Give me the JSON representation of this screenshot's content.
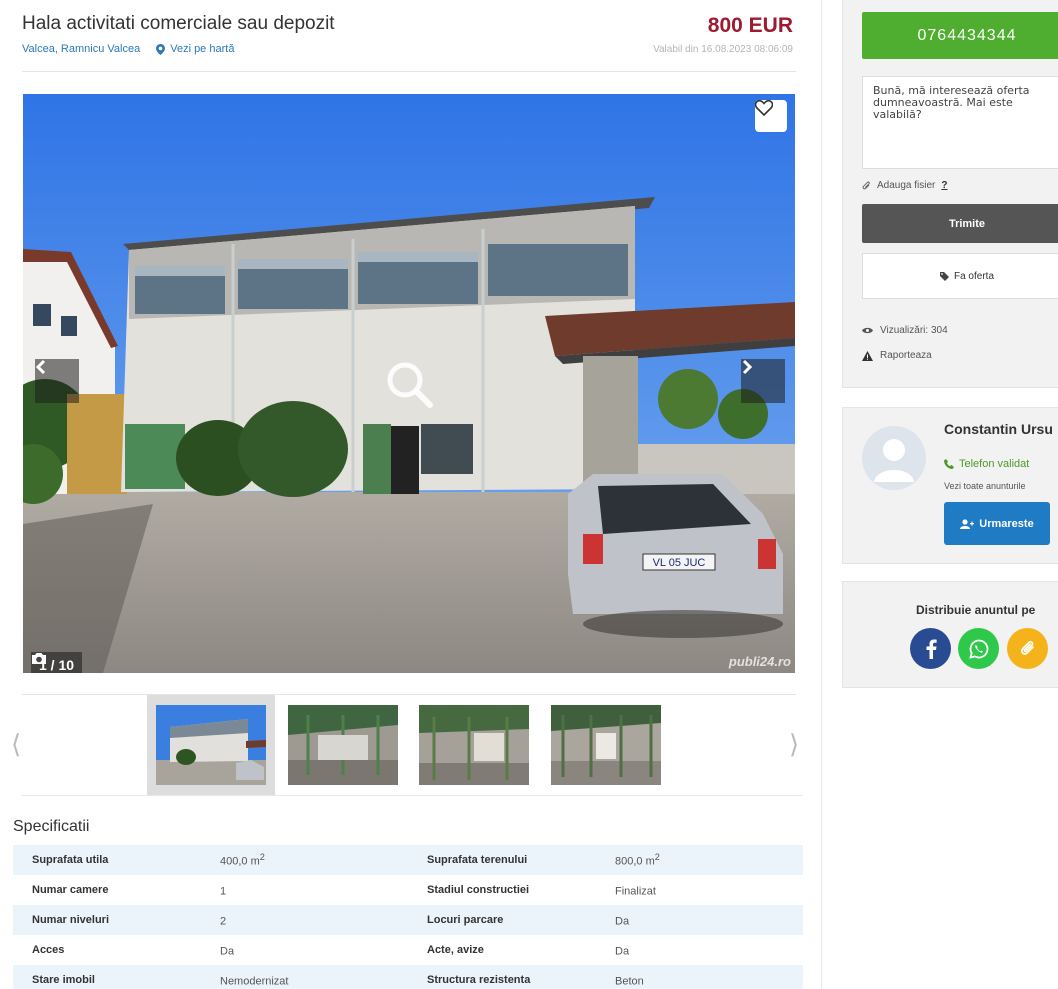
{
  "listing": {
    "title": "Hala activitati comerciale sau depozit",
    "location": "Valcea, Ramnicu Valcea",
    "map_link": "Vezi pe hartă",
    "price": "800 EUR",
    "valid_from": "Valabil din 16.08.2023 08:06:09"
  },
  "gallery": {
    "counter": "1 / 10",
    "watermark": "publi24.ro",
    "plate": "VL 05 JUC",
    "thumbnails": [
      "thumb-1",
      "thumb-2",
      "thumb-3",
      "thumb-4"
    ]
  },
  "specs": {
    "title": "Specificatii",
    "rows": [
      {
        "k1": "Suprafata utila",
        "v1": "400,0 m",
        "s1": "2",
        "k2": "Suprafata terenului",
        "v2": "800,0 m",
        "s2": "2"
      },
      {
        "k1": "Numar camere",
        "v1": "1",
        "s1": "",
        "k2": "Stadiul constructiei",
        "v2": "Finalizat",
        "s2": ""
      },
      {
        "k1": "Numar niveluri",
        "v1": "2",
        "s1": "",
        "k2": "Locuri parcare",
        "v2": "Da",
        "s2": ""
      },
      {
        "k1": "Acces",
        "v1": "Da",
        "s1": "",
        "k2": "Acte, avize",
        "v2": "Da",
        "s2": ""
      },
      {
        "k1": "Stare imobil",
        "v1": "Nemodernizat",
        "s1": "",
        "k2": "Structura rezistenta",
        "v2": "Beton",
        "s2": ""
      }
    ]
  },
  "contact": {
    "phone": "0764434344",
    "message": "Bună, mă interesează oferta dumneavoastră. Mai este valabilă?",
    "attach": "Adauga fisier",
    "attach_help": "?",
    "send": "Trimite",
    "offer": "Fa oferta",
    "views": "Vizualizări: 304",
    "report": "Raporteaza"
  },
  "seller": {
    "name": "Constantin Ursu",
    "phone_status": "Telefon validat",
    "all_ads": "Vezi toate anunturile",
    "follow": "Urmareste"
  },
  "share": {
    "title": "Distribuie anuntul pe"
  },
  "colors": {
    "price": "#9b1b30",
    "phone_button": "#4fae2f",
    "follow_button": "#1f7bc4",
    "link": "#2a7ab8"
  }
}
